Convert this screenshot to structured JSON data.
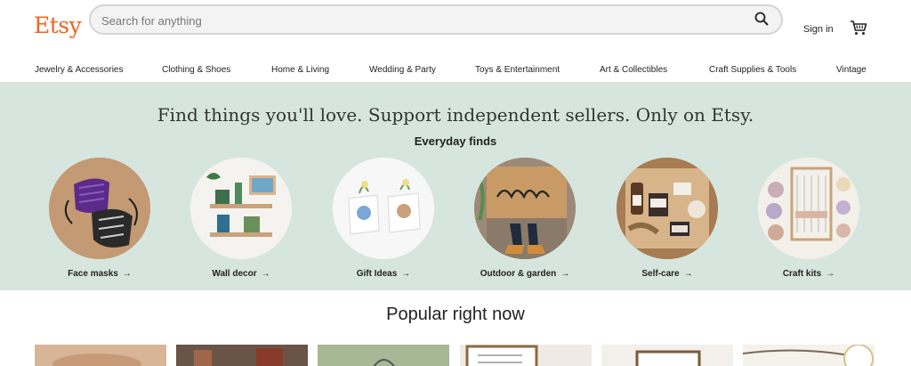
{
  "header": {
    "logo": "Etsy",
    "search_placeholder": "Search for anything",
    "signin_label": "Sign in"
  },
  "nav": {
    "items": [
      "Jewelry & Accessories",
      "Clothing & Shoes",
      "Home & Living",
      "Wedding & Party",
      "Toys & Entertainment",
      "Art & Collectibles",
      "Craft Supplies & Tools",
      "Vintage"
    ]
  },
  "hero": {
    "title": "Find things you'll love. Support independent sellers. Only on Etsy.",
    "subtitle": "Everyday finds",
    "categories": [
      {
        "label": "Face masks",
        "icon": "face-masks-image"
      },
      {
        "label": "Wall decor",
        "icon": "wall-decor-image"
      },
      {
        "label": "Gift Ideas",
        "icon": "gift-ideas-image"
      },
      {
        "label": "Outdoor & garden",
        "icon": "outdoor-garden-image"
      },
      {
        "label": "Self-care",
        "icon": "self-care-image"
      },
      {
        "label": "Craft kits",
        "icon": "craft-kits-image"
      }
    ],
    "arrow_glyph": "→"
  },
  "popular": {
    "title": "Popular right now",
    "thumbs": [
      {
        "icon": "product-thumbnail"
      },
      {
        "icon": "product-thumbnail"
      },
      {
        "icon": "product-thumbnail"
      },
      {
        "icon": "product-thumbnail"
      },
      {
        "icon": "product-thumbnail"
      },
      {
        "icon": "product-thumbnail"
      }
    ]
  },
  "colors": {
    "brand": "#f1641e",
    "hero_bg": "#d6e6df"
  }
}
